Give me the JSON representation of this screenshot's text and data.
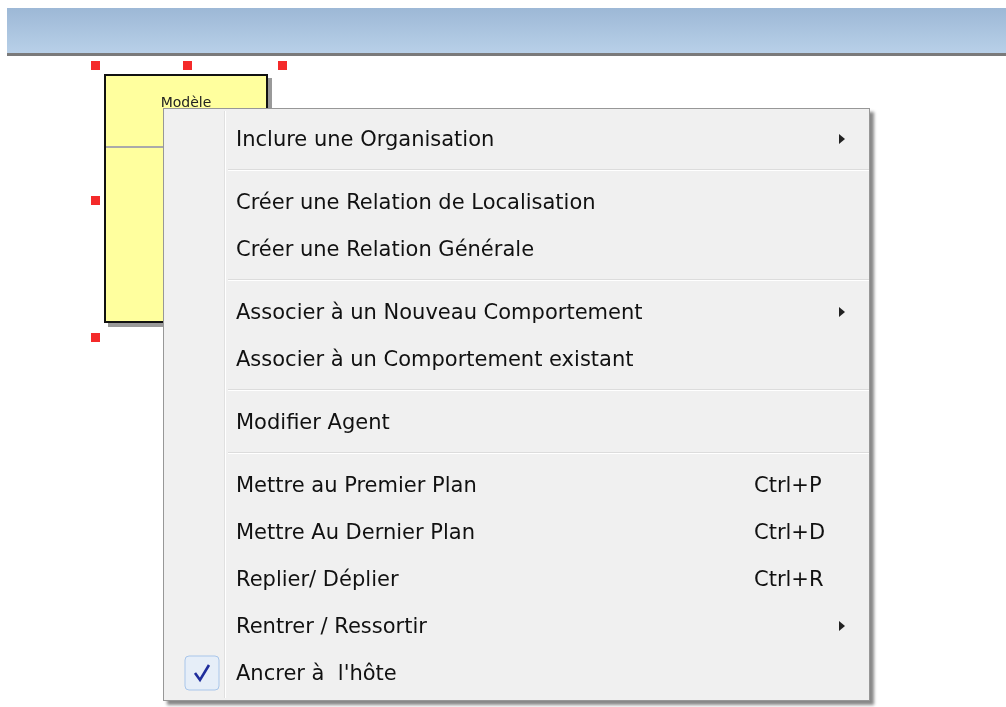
{
  "diagram": {
    "node": {
      "title": "Modèle"
    }
  },
  "context_menu": {
    "groups": [
      [
        {
          "label": "Inclure une Organisation",
          "submenu": true,
          "checked": false
        }
      ],
      [
        {
          "label": "Créer une Relation de Localisation",
          "submenu": false,
          "checked": false
        },
        {
          "label": "Créer une Relation Générale",
          "submenu": false,
          "checked": false
        }
      ],
      [
        {
          "label": "Associer à un Nouveau Comportement",
          "submenu": true,
          "checked": false
        },
        {
          "label": "Associer à un Comportement existant",
          "submenu": false,
          "checked": false
        }
      ],
      [
        {
          "label": "Modifier Agent",
          "submenu": false,
          "checked": false
        }
      ],
      [
        {
          "label": "Mettre au Premier Plan",
          "shortcut": "Ctrl+P",
          "submenu": false,
          "checked": false
        },
        {
          "label": "Mettre Au Dernier Plan",
          "shortcut": "Ctrl+D",
          "submenu": false,
          "checked": false
        },
        {
          "label": "Replier/ Déplier",
          "shortcut": "Ctrl+R",
          "submenu": false,
          "checked": false
        },
        {
          "label": "Rentrer / Ressortir",
          "submenu": true,
          "checked": false
        },
        {
          "label": "Ancrer à  l'hôte",
          "submenu": false,
          "checked": true
        }
      ]
    ]
  }
}
